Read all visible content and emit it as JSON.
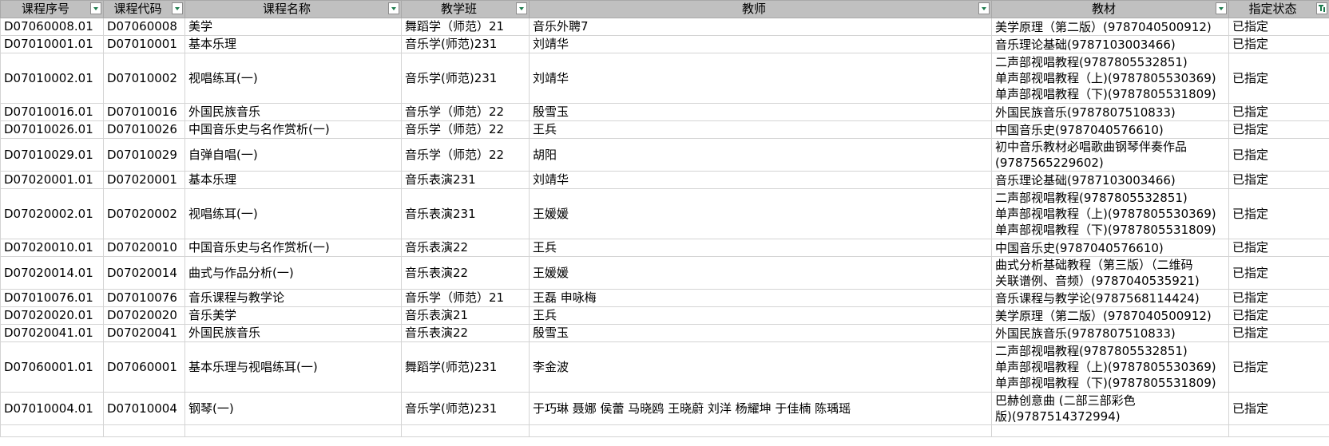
{
  "sheet": {
    "headers": [
      "课程序号",
      "课程代码",
      "课程名称",
      "教学班",
      "教师",
      "教材",
      "指定状态"
    ],
    "rows": [
      {
        "seq": "D07060008.01",
        "code": "D07060008",
        "name": "美学",
        "class": "舞蹈学（师范）21",
        "teacher": "音乐外聘7",
        "textbooks": [
          "美学原理（第二版）(9787040500912)"
        ],
        "status": "已指定"
      },
      {
        "seq": "D07010001.01",
        "code": "D07010001",
        "name": "基本乐理",
        "class": "音乐学(师范)231",
        "teacher": "刘靖华",
        "textbooks": [
          "音乐理论基础(9787103003466)"
        ],
        "status": "已指定"
      },
      {
        "seq": "D07010002.01",
        "code": "D07010002",
        "name": "视唱练耳(一)",
        "class": "音乐学(师范)231",
        "teacher": "刘靖华",
        "textbooks": [
          "二声部视唱教程(9787805532851)",
          "单声部视唱教程（上)(9787805530369)",
          "单声部视唱教程（下)(9787805531809)"
        ],
        "status": "已指定"
      },
      {
        "seq": "D07010016.01",
        "code": "D07010016",
        "name": "外国民族音乐",
        "class": "音乐学（师范）22",
        "teacher": "殷雪玉",
        "textbooks": [
          "外国民族音乐(9787807510833)"
        ],
        "status": "已指定"
      },
      {
        "seq": "D07010026.01",
        "code": "D07010026",
        "name": "中国音乐史与名作赏析(一)",
        "class": "音乐学（师范）22",
        "teacher": "王兵",
        "textbooks": [
          "中国音乐史(9787040576610)"
        ],
        "status": "已指定"
      },
      {
        "seq": "D07010029.01",
        "code": "D07010029",
        "name": "自弹自唱(一)",
        "class": "音乐学（师范）22",
        "teacher": "胡阳",
        "textbooks": [
          "初中音乐教材必唱歌曲钢琴伴奏作品",
          "(9787565229602)"
        ],
        "status": "已指定"
      },
      {
        "seq": "D07020001.01",
        "code": "D07020001",
        "name": "基本乐理",
        "class": "音乐表演231",
        "teacher": "刘靖华",
        "textbooks": [
          "音乐理论基础(9787103003466)"
        ],
        "status": "已指定"
      },
      {
        "seq": "D07020002.01",
        "code": "D07020002",
        "name": "视唱练耳(一)",
        "class": "音乐表演231",
        "teacher": "王媛媛",
        "textbooks": [
          "二声部视唱教程(9787805532851)",
          "单声部视唱教程（上)(9787805530369)",
          "单声部视唱教程（下)(9787805531809)"
        ],
        "status": "已指定"
      },
      {
        "seq": "D07020010.01",
        "code": "D07020010",
        "name": "中国音乐史与名作赏析(一)",
        "class": "音乐表演22",
        "teacher": "王兵",
        "textbooks": [
          "中国音乐史(9787040576610)"
        ],
        "status": "已指定"
      },
      {
        "seq": "D07020014.01",
        "code": "D07020014",
        "name": "曲式与作品分析(一)",
        "class": "音乐表演22",
        "teacher": "王媛媛",
        "textbooks": [
          "曲式分析基础教程（第三版）（二维码",
          "关联谱例、音频）(9787040535921)"
        ],
        "status": "已指定"
      },
      {
        "seq": "D07010076.01",
        "code": "D07010076",
        "name": "音乐课程与教学论",
        "class": "音乐学（师范）21",
        "teacher": "王磊 申咏梅",
        "textbooks": [
          "音乐课程与教学论(9787568114424)"
        ],
        "status": "已指定"
      },
      {
        "seq": "D07020020.01",
        "code": "D07020020",
        "name": "音乐美学",
        "class": "音乐表演21",
        "teacher": "王兵",
        "textbooks": [
          "美学原理（第二版）(9787040500912)"
        ],
        "status": "已指定"
      },
      {
        "seq": "D07020041.01",
        "code": "D07020041",
        "name": "外国民族音乐",
        "class": "音乐表演22",
        "teacher": "殷雪玉",
        "textbooks": [
          "外国民族音乐(9787807510833)"
        ],
        "status": "已指定"
      },
      {
        "seq": "D07060001.01",
        "code": "D07060001",
        "name": "基本乐理与视唱练耳(一)",
        "class": "舞蹈学(师范)231",
        "teacher": "李金波",
        "textbooks": [
          "二声部视唱教程(9787805532851)",
          "单声部视唱教程（上)(9787805530369)",
          "单声部视唱教程（下)(9787805531809)"
        ],
        "status": "已指定"
      },
      {
        "seq": "D07010004.01",
        "code": "D07010004",
        "name": "钢琴(一)",
        "class": "音乐学(师范)231",
        "teacher": "于巧琳 聂娜 侯蕾 马晓鸥 王晓蔚 刘洋 杨耀坤 于佳楠 陈瑀瑶",
        "textbooks": [
          "巴赫创意曲 (二部三部彩色",
          "版)(9787514372994)"
        ],
        "status": "已指定"
      }
    ]
  }
}
